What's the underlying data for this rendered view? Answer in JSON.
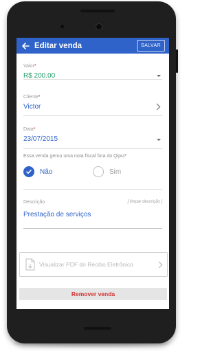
{
  "appbar": {
    "title": "Editar venda",
    "save_label": "SALVAR"
  },
  "form": {
    "valor": {
      "label": "Valor",
      "required_mark": "*",
      "value": "R$ 200.00"
    },
    "cliente": {
      "label": "Cliente",
      "required_mark": "*",
      "value": "Victor"
    },
    "data": {
      "label": "Data",
      "required_mark": "*",
      "value": "23/07/2015"
    },
    "nota_question": "Essa venda gerou uma nota fiscal fora do Qipu?",
    "radio": {
      "selected": "Não",
      "options": [
        "Não",
        "Sim"
      ]
    },
    "descricao": {
      "label": "Descrição",
      "clear_label": "[ limpar descrição ]",
      "value": "Prestação de serviços"
    }
  },
  "pdf": {
    "label": "Visualizar PDF do Recibo Eletrônico"
  },
  "remove_label": "Remover venda",
  "colors": {
    "primary": "#2f63c9",
    "valor_value": "#1f9c6b",
    "danger": "#d32f2f"
  }
}
